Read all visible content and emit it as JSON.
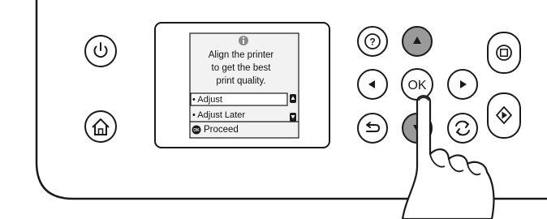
{
  "screen": {
    "message_lines": [
      "Align the printer",
      "to get the best",
      "print quality."
    ],
    "options": [
      {
        "label": "• Adjust",
        "selected": true
      },
      {
        "label": "• Adjust Later",
        "selected": false
      }
    ],
    "footer": {
      "badge": "OK",
      "label": "Proceed"
    }
  },
  "buttons": {
    "help": "?",
    "up": "▲",
    "left": "◀",
    "ok": "OK",
    "right": "▶",
    "back": "back-arrow",
    "down": "▼",
    "refresh": "refresh-arrows",
    "power": "power",
    "home": "home",
    "stop": "stop",
    "start": "start"
  },
  "colors": {
    "panel_outline": "#1a1a1a",
    "button_gray": "#9a9a9a",
    "screen_bg": "#f2f2f2",
    "hand_fill": "#ffffff"
  }
}
